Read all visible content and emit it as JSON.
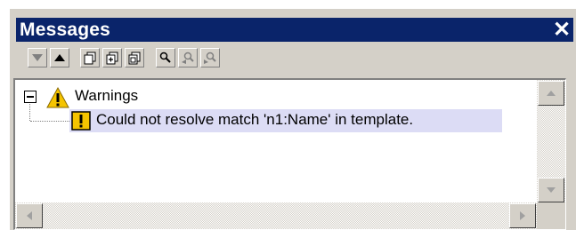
{
  "window": {
    "title": "Messages",
    "close_glyph": "✕"
  },
  "toolbar": {
    "buttons": [
      {
        "icon": "arrow-down-icon",
        "enabled": false
      },
      {
        "icon": "arrow-up-icon",
        "enabled": true
      },
      {
        "icon": "copy-icon",
        "enabled": true
      },
      {
        "icon": "copy-all-icon",
        "enabled": true
      },
      {
        "icon": "copy-message-icon",
        "enabled": true
      },
      {
        "icon": "find-icon",
        "enabled": true
      },
      {
        "icon": "find-previous-icon",
        "enabled": false
      },
      {
        "icon": "find-next-icon",
        "enabled": false
      }
    ]
  },
  "messages": {
    "group_label": "Warnings",
    "group_expanded": true,
    "items": [
      {
        "text": "Could not resolve match 'n1:Name' in template.",
        "severity": "warning",
        "selected": true
      }
    ]
  },
  "colors": {
    "titlebar": "#0a246a",
    "selection": "#dcdcf5",
    "warning_yellow": "#f5c400",
    "chrome": "#d4d0c8"
  }
}
